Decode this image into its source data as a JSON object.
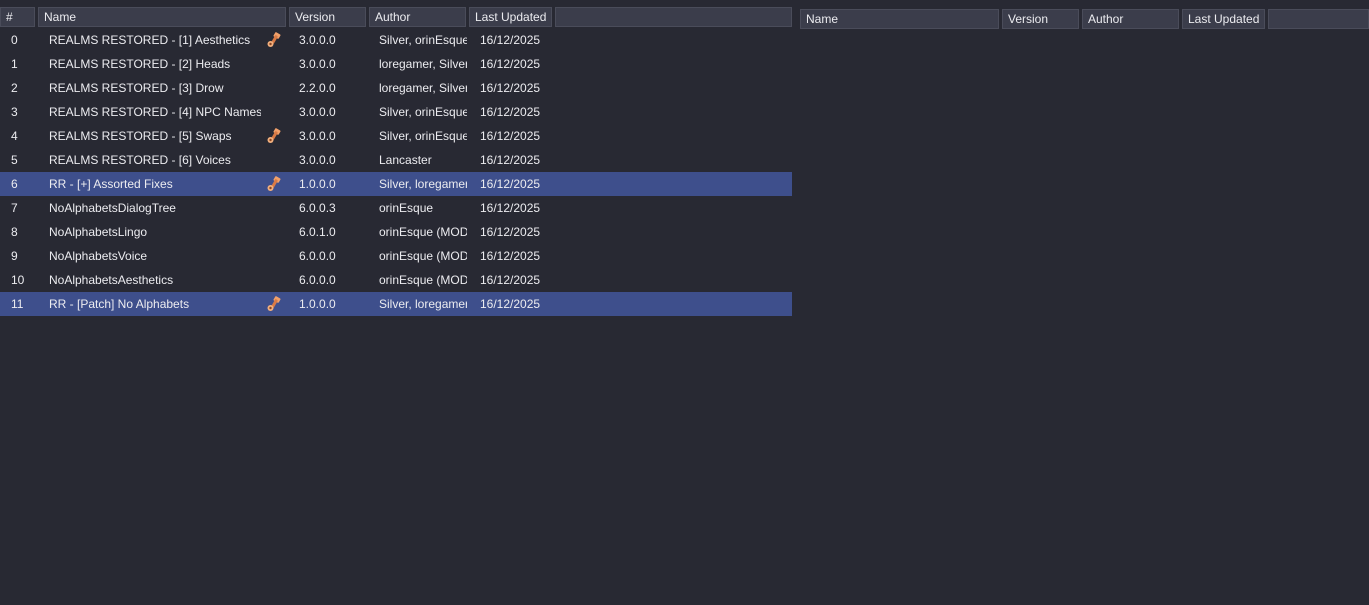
{
  "left_table": {
    "columns": [
      "#",
      "Name",
      "Version",
      "Author",
      "Last Updated",
      ""
    ],
    "rows": [
      {
        "index": "0",
        "name": "REALMS RESTORED - [1] Aesthetics",
        "version": "3.0.0.0",
        "author": "Silver, orinEsque,",
        "updated": "16/12/2025",
        "has_icon": true,
        "selected": false
      },
      {
        "index": "1",
        "name": "REALMS RESTORED - [2] Heads",
        "version": "3.0.0.0",
        "author": "loregamer, Silver",
        "updated": "16/12/2025",
        "has_icon": false,
        "selected": false
      },
      {
        "index": "2",
        "name": "REALMS RESTORED - [3] Drow",
        "version": "2.2.0.0",
        "author": "loregamer, Silver",
        "updated": "16/12/2025",
        "has_icon": false,
        "selected": false
      },
      {
        "index": "3",
        "name": "REALMS RESTORED - [4] NPC Names",
        "version": "3.0.0.0",
        "author": "Silver, orinEsque,",
        "updated": "16/12/2025",
        "has_icon": false,
        "selected": false
      },
      {
        "index": "4",
        "name": "REALMS RESTORED - [5] Swaps",
        "version": "3.0.0.0",
        "author": "Silver, orinEsque,",
        "updated": "16/12/2025",
        "has_icon": true,
        "selected": false
      },
      {
        "index": "5",
        "name": "REALMS RESTORED - [6] Voices",
        "version": "3.0.0.0",
        "author": "Lancaster",
        "updated": "16/12/2025",
        "has_icon": false,
        "selected": false
      },
      {
        "index": "6",
        "name": "RR - [+] Assorted Fixes",
        "version": "1.0.0.0",
        "author": "Silver, loregamer",
        "updated": "16/12/2025",
        "has_icon": true,
        "selected": true
      },
      {
        "index": "7",
        "name": "NoAlphabetsDialogTree",
        "version": "6.0.0.3",
        "author": "orinEsque",
        "updated": "16/12/2025",
        "has_icon": false,
        "selected": false
      },
      {
        "index": "8",
        "name": "NoAlphabetsLingo",
        "version": "6.0.1.0",
        "author": "orinEsque (MOD",
        "updated": "16/12/2025",
        "has_icon": false,
        "selected": false
      },
      {
        "index": "9",
        "name": "NoAlphabetsVoice",
        "version": "6.0.0.0",
        "author": "orinEsque (MOD",
        "updated": "16/12/2025",
        "has_icon": false,
        "selected": false
      },
      {
        "index": "10",
        "name": "NoAlphabetsAesthetics",
        "version": "6.0.0.0",
        "author": "orinEsque (MOD",
        "updated": "16/12/2025",
        "has_icon": false,
        "selected": false
      },
      {
        "index": "11",
        "name": "RR - [Patch] No Alphabets",
        "version": "1.0.0.0",
        "author": "Silver, loregamer",
        "updated": "16/12/2025",
        "has_icon": true,
        "selected": true
      }
    ]
  },
  "right_table": {
    "columns": [
      "Name",
      "Version",
      "Author",
      "Last Updated",
      ""
    ],
    "rows": []
  },
  "icons": {
    "row_icon": "dependency-tool-icon"
  },
  "colors": {
    "background": "#282933",
    "header": "#3b3d4b",
    "selected_row": "#3e4f8c",
    "icon": "#e8925a"
  }
}
